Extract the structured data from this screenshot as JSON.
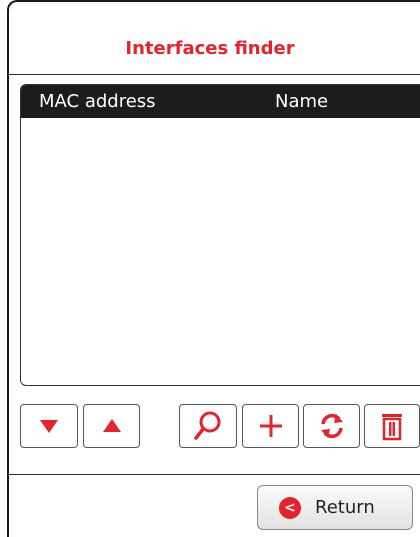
{
  "title": "Interfaces finder",
  "table": {
    "columns": [
      "MAC address",
      "Name"
    ],
    "rows": []
  },
  "toolbar": {
    "buttons": [
      {
        "icon": "arrow-down-icon"
      },
      {
        "icon": "arrow-up-icon"
      },
      {
        "icon": "search-icon"
      },
      {
        "icon": "plus-icon"
      },
      {
        "icon": "refresh-icon"
      },
      {
        "icon": "trash-icon"
      }
    ]
  },
  "footer": {
    "return_label": "Return",
    "return_glyph": "<"
  },
  "colors": {
    "accent": "#e5232d",
    "header_bg": "#1c1c1c"
  }
}
